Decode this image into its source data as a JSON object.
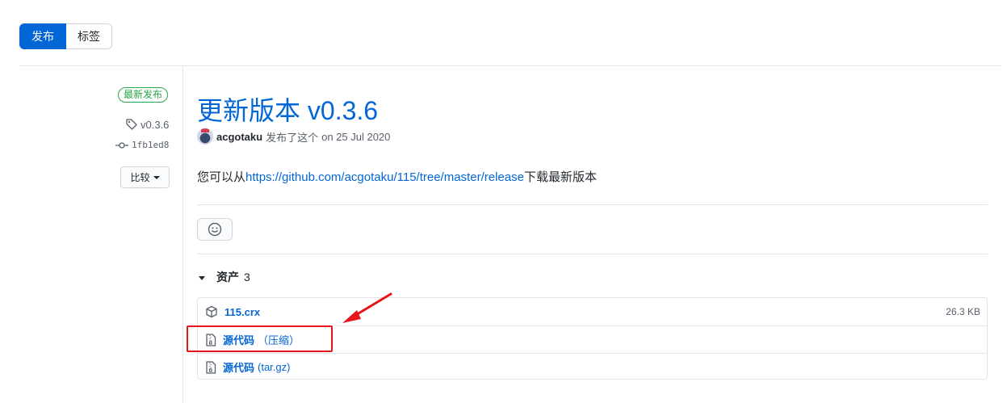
{
  "tabs": [
    {
      "label": "发布",
      "active": true
    },
    {
      "label": "标签",
      "active": false
    }
  ],
  "sidebar": {
    "latest_badge": "最新发布",
    "tag": "v0.3.6",
    "commit": "1fb1ed8",
    "compare_label": "比较"
  },
  "release": {
    "title": "更新版本 v0.3.6",
    "author": "acgotaku",
    "published_text": "发布了这个",
    "date_text": "on 25 Jul 2020",
    "body_prefix": "您可以从",
    "body_link": "https://github.com/acgotaku/115/tree/master/release",
    "body_suffix": "下载最新版本"
  },
  "assets": {
    "label": "资产",
    "count": "3",
    "items": [
      {
        "name": "115.crx",
        "suffix": "",
        "size": "26.3 KB",
        "icon": "package-icon"
      },
      {
        "name": "源代码",
        "suffix": "（压缩）",
        "size": "",
        "icon": "file-zip-icon"
      },
      {
        "name": "源代码",
        "suffix": "(tar.gz)",
        "size": "",
        "icon": "file-zip-icon"
      }
    ]
  },
  "colors": {
    "accent": "#0366d6",
    "latest_green": "#28a745",
    "annotation_red": "#e8141b"
  }
}
